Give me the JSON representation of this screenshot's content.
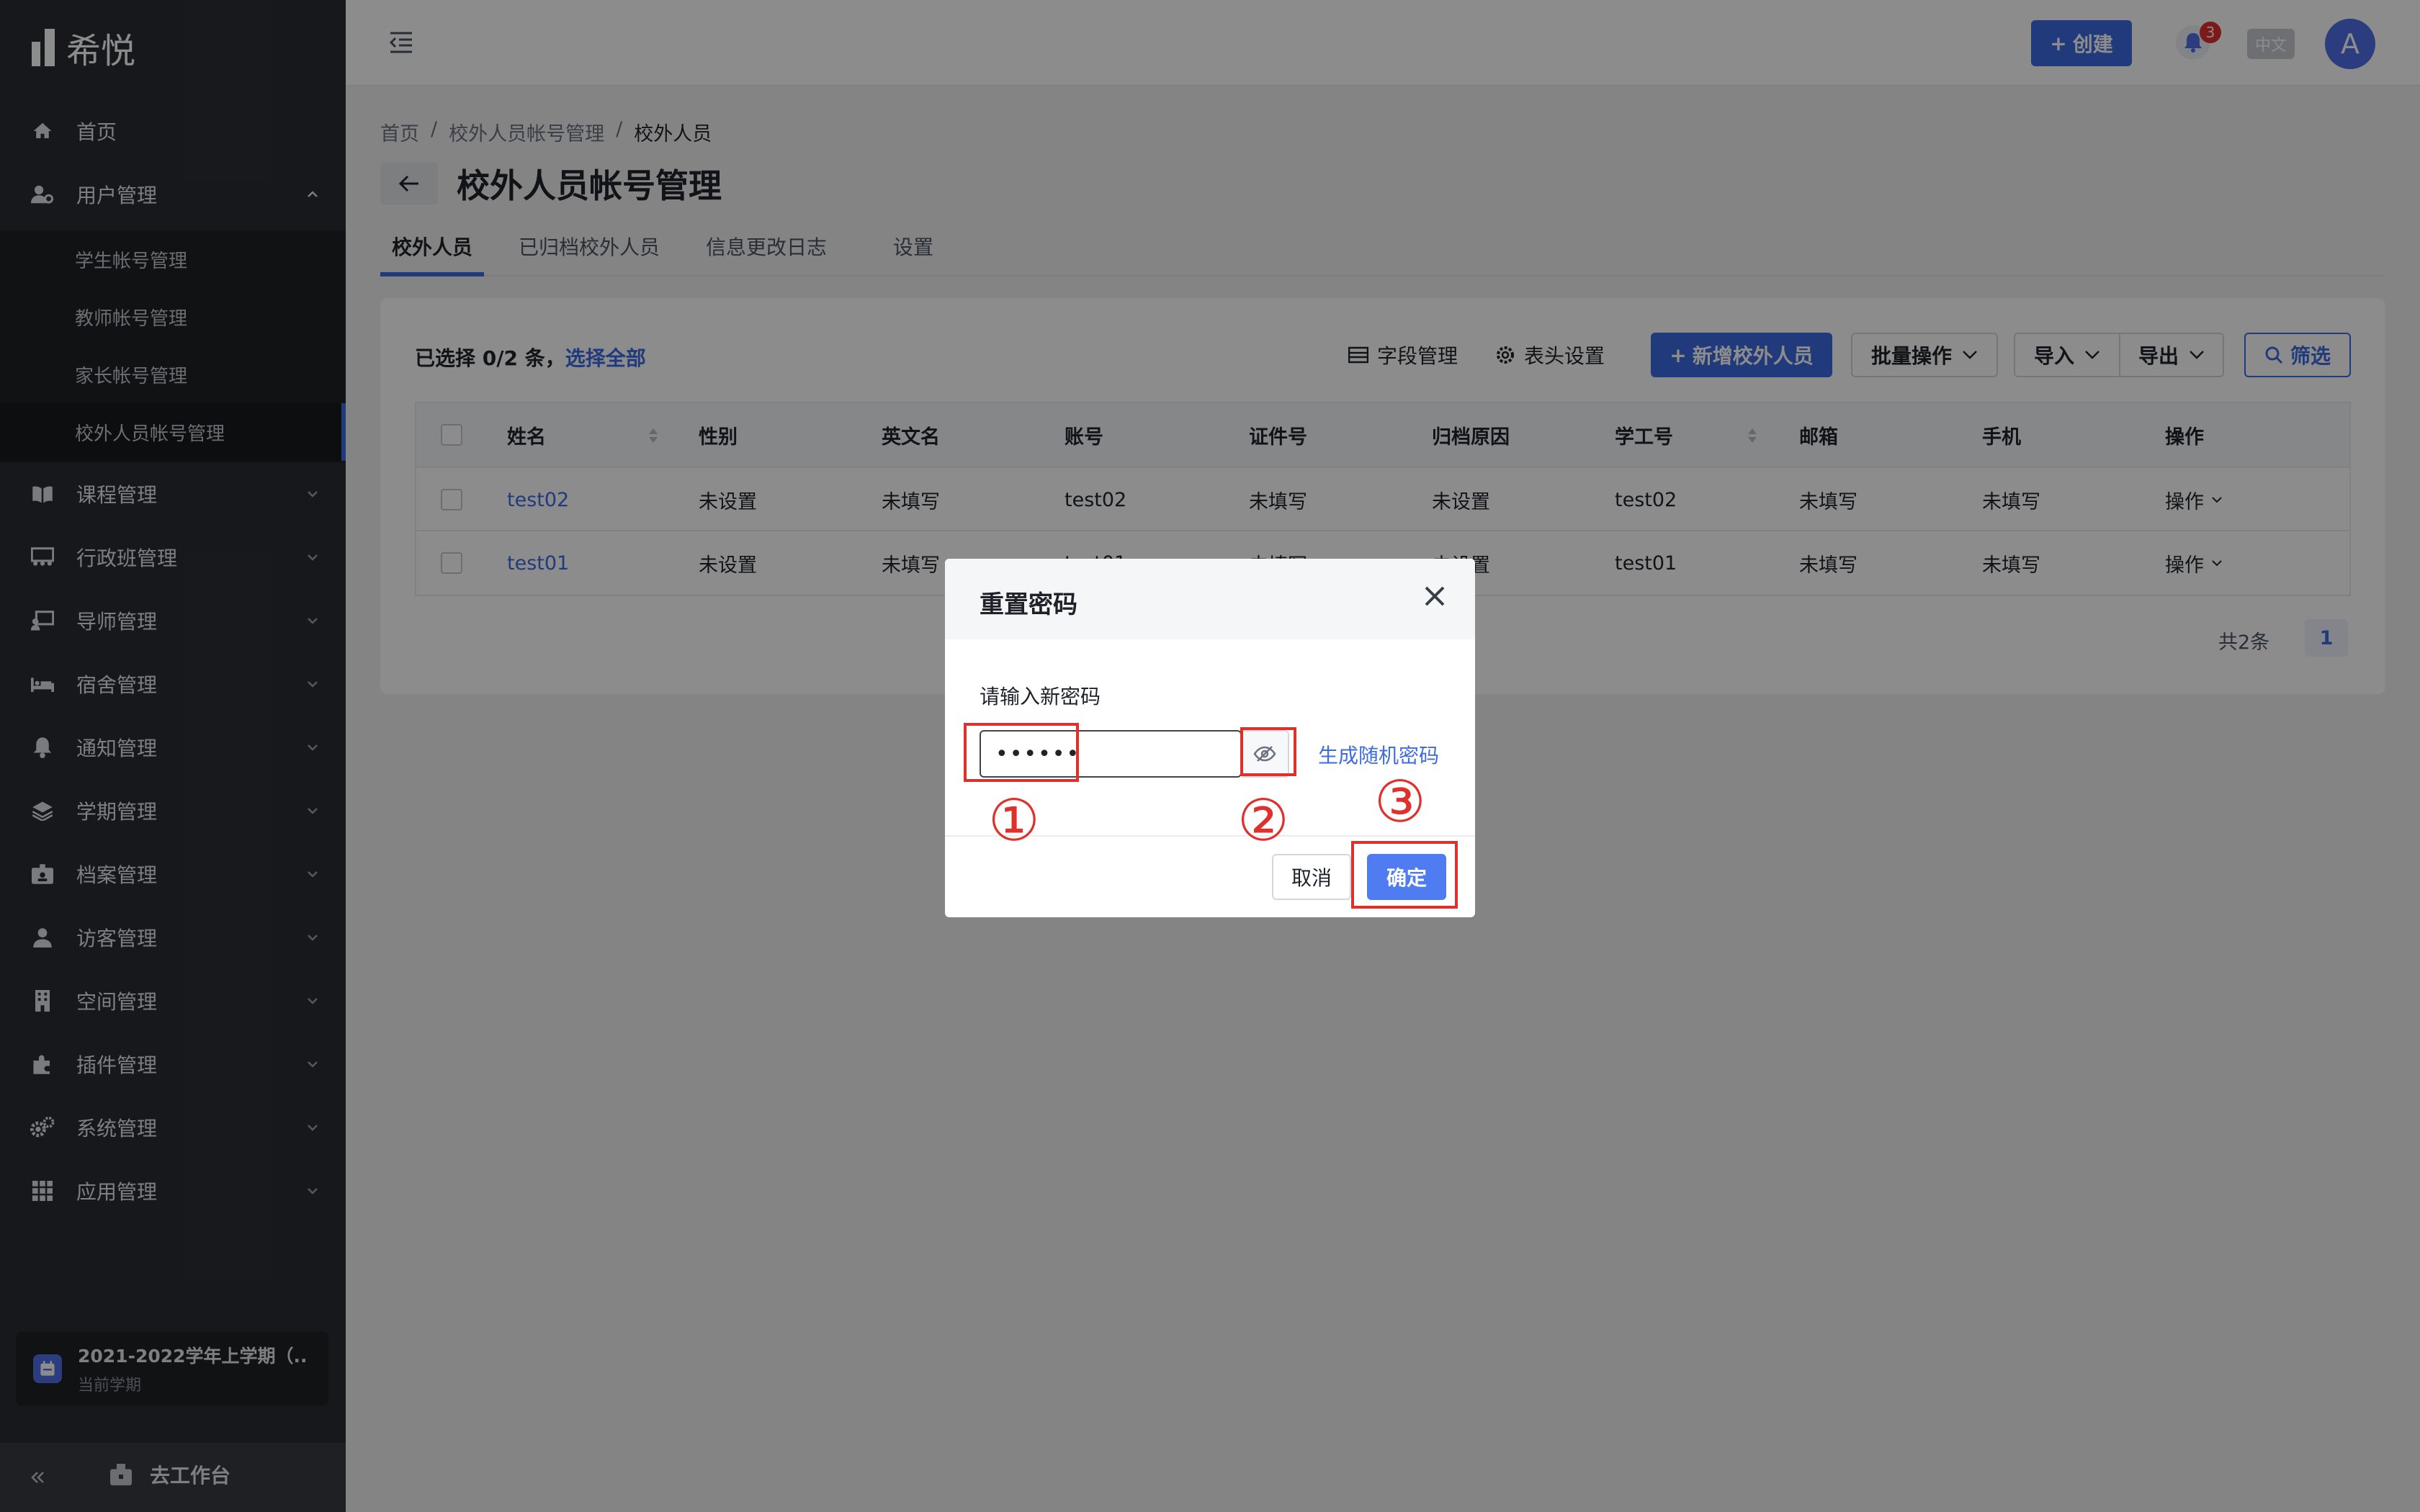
{
  "app": {
    "name": "希悦"
  },
  "sidebar": {
    "items": [
      {
        "label": "首页",
        "icon": "home-icon"
      },
      {
        "label": "用户管理",
        "icon": "user-settings-icon"
      },
      {
        "label": "课程管理",
        "icon": "book-icon"
      },
      {
        "label": "行政班管理",
        "icon": "class-icon"
      },
      {
        "label": "导师管理",
        "icon": "tutor-icon"
      },
      {
        "label": "宿舍管理",
        "icon": "bed-icon"
      },
      {
        "label": "通知管理",
        "icon": "bell-icon"
      },
      {
        "label": "学期管理",
        "icon": "layers-icon"
      },
      {
        "label": "档案管理",
        "icon": "id-badge-icon"
      },
      {
        "label": "访客管理",
        "icon": "visitor-icon"
      },
      {
        "label": "空间管理",
        "icon": "building-icon"
      },
      {
        "label": "插件管理",
        "icon": "puzzle-icon"
      },
      {
        "label": "系统管理",
        "icon": "gears-icon"
      },
      {
        "label": "应用管理",
        "icon": "grid-icon"
      }
    ],
    "sub_items": [
      "学生帐号管理",
      "教师帐号管理",
      "家长帐号管理",
      "校外人员帐号管理"
    ],
    "term": {
      "name": "2021-2022学年上学期（...",
      "caption": "当前学期"
    },
    "workbench_label": "去工作台"
  },
  "header": {
    "create_label": "创建",
    "notification_count": "3",
    "language": "中文",
    "avatar_letter": "A"
  },
  "breadcrumb": [
    "首页",
    "校外人员帐号管理",
    "校外人员"
  ],
  "breadcrumb_sep": "/",
  "page": {
    "title": "校外人员帐号管理"
  },
  "tabs": [
    "校外人员",
    "已归档校外人员",
    "信息更改日志",
    "设置"
  ],
  "toolbar": {
    "selection_prefix": "已选择 0/2 条，",
    "select_all": "选择全部",
    "field_manage": "字段管理",
    "header_settings": "表头设置",
    "add_person": "新增校外人员",
    "batch": "批量操作",
    "import": "导入",
    "export": "导出",
    "filter": "筛选"
  },
  "table": {
    "columns": [
      "姓名",
      "性别",
      "英文名",
      "账号",
      "证件号",
      "归档原因",
      "学工号",
      "邮箱",
      "手机",
      "操作"
    ],
    "rows": [
      {
        "name": "test02",
        "gender": "未设置",
        "english_name": "未填写",
        "account": "test02",
        "id_no": "未填写",
        "archive_reason": "未设置",
        "staff_no": "test02",
        "email": "未填写",
        "phone": "未填写",
        "action": "操作"
      },
      {
        "name": "test01",
        "gender": "未设置",
        "english_name": "未填写",
        "account": "test01",
        "id_no": "未填写",
        "archive_reason": "未设置",
        "staff_no": "test01",
        "email": "未填写",
        "phone": "未填写",
        "action": "操作"
      }
    ]
  },
  "pagination": {
    "total": "共2条",
    "current": "1"
  },
  "modal": {
    "title": "重置密码",
    "label": "请输入新密码",
    "password_value": "••••••",
    "generate_label": "生成随机密码",
    "cancel_label": "取消",
    "confirm_label": "确定"
  },
  "annotations": [
    "①",
    "②",
    "③"
  ],
  "colors": {
    "accent": "#3d6be0",
    "sidebar": "#2a2d33",
    "annotation": "#e0302c",
    "badge": "#e0302c"
  }
}
